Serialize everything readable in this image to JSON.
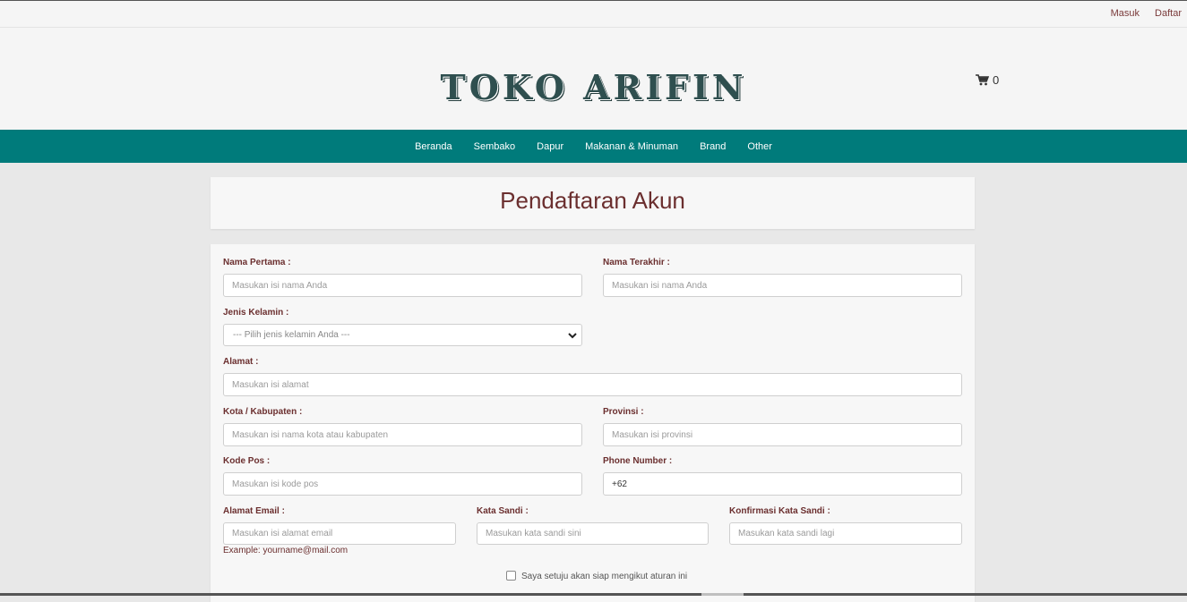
{
  "topbar": {
    "login": "Masuk",
    "register": "Daftar"
  },
  "header": {
    "logo": "TOKO ARIFIN",
    "cart_count": "0"
  },
  "nav": [
    "Beranda",
    "Sembako",
    "Dapur",
    "Makanan & Minuman",
    "Brand",
    "Other"
  ],
  "page_title": "Pendaftaran Akun",
  "form": {
    "first_name": {
      "label": "Nama Pertama :",
      "placeholder": "Masukan isi nama Anda"
    },
    "last_name": {
      "label": "Nama Terakhir :",
      "placeholder": "Masukan isi nama Anda"
    },
    "gender": {
      "label": "Jenis Kelamin :",
      "selected": "--- Pilih jenis kelamin Anda ---"
    },
    "address": {
      "label": "Alamat :",
      "placeholder": "Masukan isi alamat"
    },
    "city": {
      "label": "Kota / Kabupaten :",
      "placeholder": "Masukan isi nama kota atau kabupaten"
    },
    "province": {
      "label": "Provinsi :",
      "placeholder": "Masukan isi provinsi"
    },
    "postal": {
      "label": "Kode Pos :",
      "placeholder": "Masukan isi kode pos"
    },
    "phone": {
      "label": "Phone Number :",
      "value": "+62"
    },
    "email": {
      "label": "Alamat Email :",
      "placeholder": "Masukan isi alamat email",
      "hint": "Example: yourname@mail.com"
    },
    "password": {
      "label": "Kata Sandi :",
      "placeholder": "Masukan kata sandi sini"
    },
    "confirm": {
      "label": "Konfirmasi Kata Sandi :",
      "placeholder": "Masukan kata sandi lagi"
    },
    "agree": "Saya setuju akan siap mengikut aturan ini"
  },
  "colors": {
    "teal": "#007b7b",
    "maroon": "#6b2f2f",
    "logo": "#2f4f4f"
  },
  "icons": {
    "cart": "shopping-cart-icon",
    "select": "chevron-down-icon"
  }
}
